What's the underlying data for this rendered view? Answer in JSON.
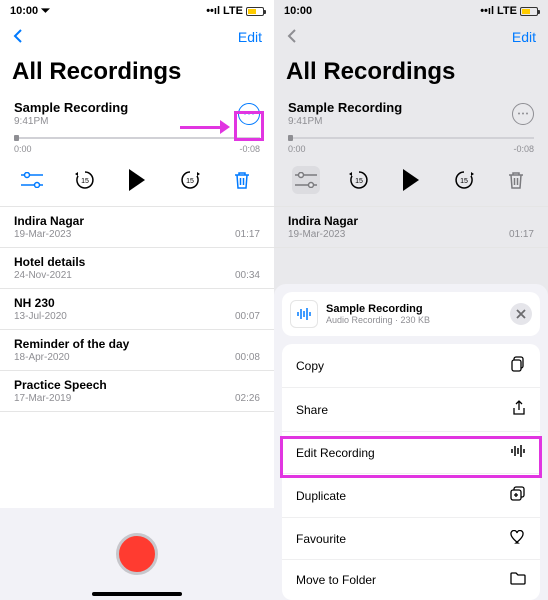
{
  "status": {
    "time": "10:00",
    "net": "LTE"
  },
  "nav": {
    "edit": "Edit"
  },
  "title": "All Recordings",
  "selected": {
    "name": "Sample Recording",
    "time": "9:41PM",
    "start": "0:00",
    "end": "-0:08"
  },
  "items": [
    {
      "name": "Indira Nagar",
      "date": "19-Mar-2023",
      "dur": "01:17"
    },
    {
      "name": "Hotel details",
      "date": "24-Nov-2021",
      "dur": "00:34"
    },
    {
      "name": "NH 230",
      "date": "13-Jul-2020",
      "dur": "00:07"
    },
    {
      "name": "Reminder of the day",
      "date": "18-Apr-2020",
      "dur": "00:08"
    },
    {
      "name": "Practice Speech",
      "date": "17-Mar-2019",
      "dur": "02:26"
    }
  ],
  "sheet": {
    "title": "Sample Recording",
    "subtitle": "Audio Recording · 230 KB",
    "actions": [
      {
        "label": "Copy",
        "icon": "copy"
      },
      {
        "label": "Share",
        "icon": "share"
      },
      {
        "label": "Edit Recording",
        "icon": "waveform"
      },
      {
        "label": "Duplicate",
        "icon": "duplicate"
      },
      {
        "label": "Favourite",
        "icon": "heart"
      },
      {
        "label": "Move to Folder",
        "icon": "folder"
      }
    ]
  }
}
